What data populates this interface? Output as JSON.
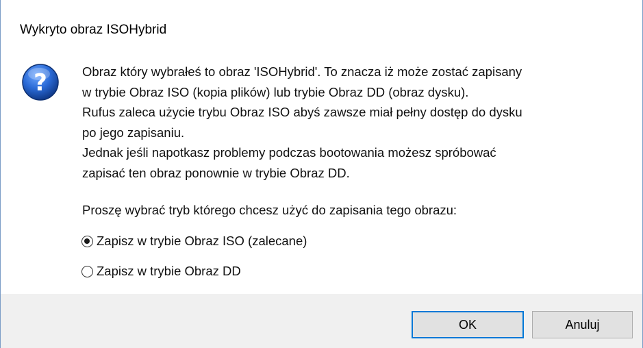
{
  "dialog": {
    "title": "Wykryto obraz ISOHybrid",
    "icon": "question-icon",
    "message_lines": [
      "Obraz który wybrałeś to obraz 'ISOHybrid'. To znacza iż może zostać zapisany",
      "w trybie Obraz ISO (kopia plików) lub trybie Obraz DD (obraz dysku).",
      "Rufus zaleca użycie trybu Obraz ISO abyś zawsze miał pełny dostęp do dysku",
      "po jego zapisaniu.",
      "Jednak jeśli napotkasz problemy podczas bootowania możesz spróbować",
      "zapisać ten obraz ponownie w trybie Obraz DD."
    ],
    "prompt": "Proszę wybrać tryb którego chcesz użyć do zapisania tego obrazu:",
    "options": [
      {
        "label": "Zapisz w trybie Obraz ISO (zalecane)",
        "selected": true
      },
      {
        "label": "Zapisz w trybie Obraz DD",
        "selected": false
      }
    ],
    "buttons": {
      "ok_label": "OK",
      "cancel_label": "Anuluj"
    },
    "colors": {
      "footer_bg": "#f0f0f0",
      "accent": "#0078d7",
      "icon_blue": "#1f5fbf"
    }
  }
}
